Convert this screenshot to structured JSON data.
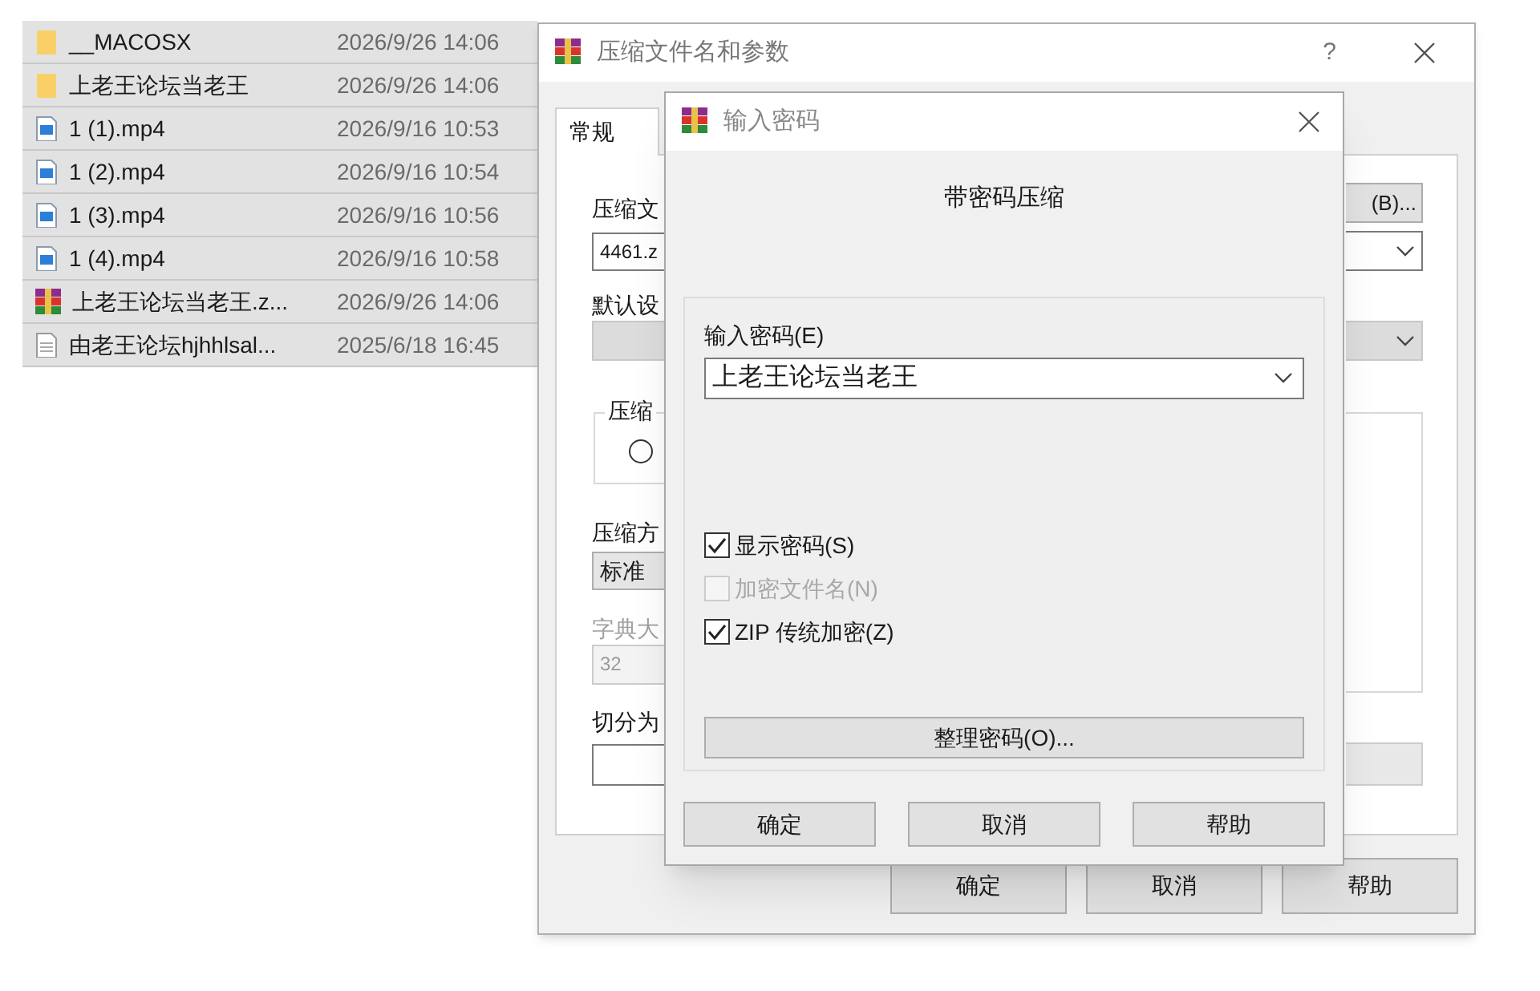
{
  "files": [
    {
      "name": "__MACOSX",
      "date": "2026/9/26 14:06",
      "kind": "folder"
    },
    {
      "name": "上老王论坛当老王",
      "date": "2026/9/26 14:06",
      "kind": "folder"
    },
    {
      "name": "1 (1).mp4",
      "date": "2026/9/16 10:53",
      "kind": "video"
    },
    {
      "name": "1 (2).mp4",
      "date": "2026/9/16 10:54",
      "kind": "video"
    },
    {
      "name": "1 (3).mp4",
      "date": "2026/9/16 10:56",
      "kind": "video"
    },
    {
      "name": "1 (4).mp4",
      "date": "2026/9/16 10:58",
      "kind": "video"
    },
    {
      "name": "上老王论坛当老王.z...",
      "date": "2026/9/26 14:06",
      "kind": "archive"
    },
    {
      "name": "由老王论坛hjhhlsal...",
      "date": "2025/6/18 16:45",
      "kind": "text"
    }
  ],
  "back_dialog": {
    "title": "压缩文件名和参数",
    "help": "?",
    "tabs": [
      {
        "label": "常规",
        "selected": true
      }
    ],
    "archive_label": "压缩文",
    "archive_name": "4461.z",
    "browse_button": "(B)...",
    "profile_label": "默认设",
    "group_label": "压缩",
    "radio": {
      "selected": false
    },
    "method_label": "压缩方",
    "method_value": "标准",
    "dictionary": {
      "label": "字典大",
      "value": "32",
      "disabled": true
    },
    "split_label": "切分为",
    "buttons": [
      "确定",
      "取消",
      "帮助"
    ]
  },
  "front_dialog": {
    "title": "输入密码",
    "heading": "带密码压缩",
    "password_label": "输入密码(E)",
    "password_value": "上老王论坛当老王",
    "options": [
      {
        "label": "显示密码(S)",
        "checked": true,
        "disabled": false
      },
      {
        "label": "加密文件名(N)",
        "checked": false,
        "disabled": true
      },
      {
        "label": "ZIP 传统加密(Z)",
        "checked": true,
        "disabled": false
      }
    ],
    "manage_button": "整理密码(O)...",
    "buttons": [
      "确定",
      "取消",
      "帮助"
    ]
  }
}
